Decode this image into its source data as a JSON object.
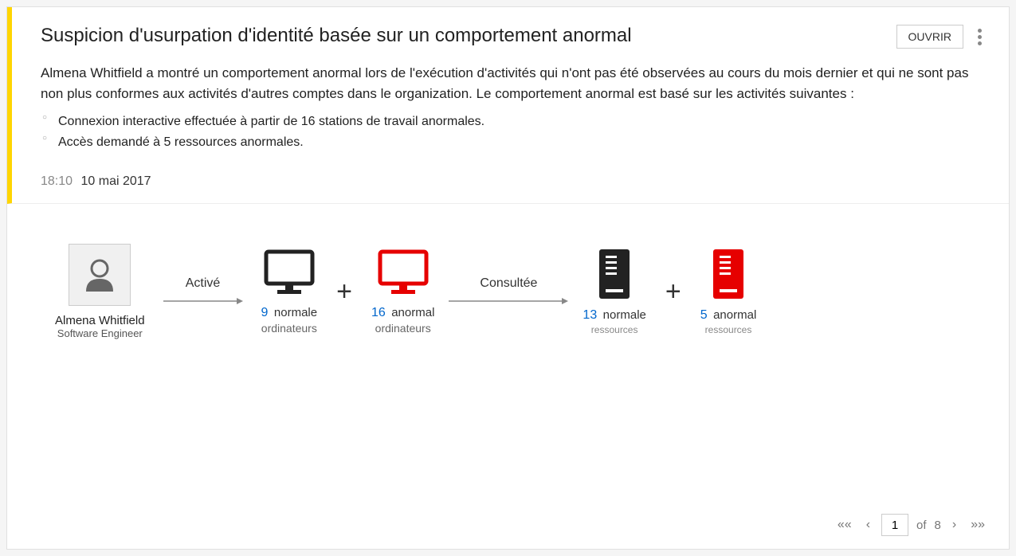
{
  "alert": {
    "title": "Suspicion d'usurpation d'identité basée sur un comportement anormal",
    "open_button": "OUVRIR",
    "description": "Almena Whitfield a montré un comportement anormal lors de l'exécution d'activités qui n'ont pas été observées au cours du mois dernier et qui ne sont pas non plus conformes aux activités d'autres comptes dans le organization. Le comportement anormal est basé sur les activités suivantes :",
    "bullets": [
      "Connexion interactive effectuée à partir de 16 stations de travail anormales.",
      "Accès demandé à 5 ressources anormales."
    ],
    "time": "18:10",
    "date": "10 mai 2017"
  },
  "diagram": {
    "user": {
      "name": "Almena Whitfield",
      "role": "Software Engineer"
    },
    "arrow1": "Activé",
    "computers_normal": {
      "count": "9",
      "state": "normale",
      "sub": "ordinateurs"
    },
    "computers_abnormal": {
      "count": "16",
      "state": "anormal",
      "sub": "ordinateurs"
    },
    "arrow2": "Consultée",
    "resources_normal": {
      "count": "13",
      "state": "normale",
      "sub": "ressources"
    },
    "resources_abnormal": {
      "count": "5",
      "state": "anormal",
      "sub": "ressources"
    }
  },
  "pagination": {
    "current": "1",
    "of_label": "of",
    "total": "8"
  },
  "colors": {
    "accent": "#ffd500",
    "abnormal": "#e60000",
    "link": "#0066cc"
  }
}
